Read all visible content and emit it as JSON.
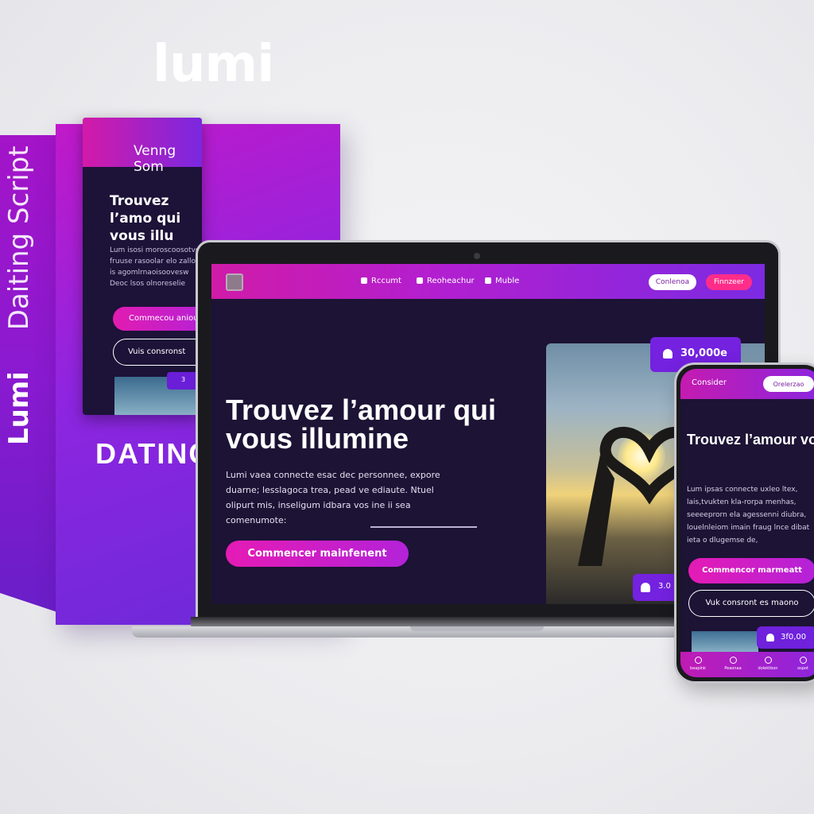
{
  "box": {
    "logo": "lumi",
    "spine_brand": "Lumi",
    "spine_sub": "Daiting Script",
    "bottom_text": "DATING",
    "screen": {
      "header_text": "Venng Som",
      "title": "Trouvez l’amo qui vous illu",
      "body": "Lum isosi moroscoosotvo fruuse rasoolar elo zalloe is agomlrnaoisoovesw Deoc lsos olnoreselie",
      "cta_primary": "Commecou aniou",
      "cta_secondary": "Vuis consronst",
      "chip": "3"
    }
  },
  "laptop": {
    "nav": {
      "items": [
        {
          "label": "Rccumt"
        },
        {
          "label": "Reoheachur"
        },
        {
          "label": "Muble"
        }
      ],
      "btn_secondary": "Conlenoa",
      "btn_primary": "Finnzeer"
    },
    "hero": {
      "title": "Trouvez l’amour qui vous illumine",
      "body": "Lumi vaea connecte esac dec personnee, expore duarne;  lesslagoca trea, pead ve ediaute. Ntuel olipurt mis, inseligum idbara vos ine ii sea comenumote:",
      "cta": "Commencer mainfenent"
    },
    "badge_top": "30,000e",
    "badge_bottom": "3.0"
  },
  "phone": {
    "header_label": "Consider",
    "header_btn": "Orelerzao",
    "title": "Trouvez l’amour vous illumina",
    "body": "Lum ipsas connecte uxleo ltex, lais,tvukten kla-rorpa menhas, seeeeprorn ela agessenni diubra, louelnleiom imain fraug lnce dibat ieta o dlugemse de,",
    "cta_primary": "Commencor marmeatt",
    "cta_secondary": "Vuk consront es maono",
    "chip": "3f0,00",
    "tabs": [
      {
        "label": "beaplnk"
      },
      {
        "label": "Peaonaa"
      },
      {
        "label": "dolektbon"
      },
      {
        "label": "ospot"
      }
    ]
  },
  "colors": {
    "magenta": "#d01ba8",
    "violet": "#7c2ae2",
    "dark_bg": "#1c1335",
    "cta_pink": "#e51bb5"
  }
}
